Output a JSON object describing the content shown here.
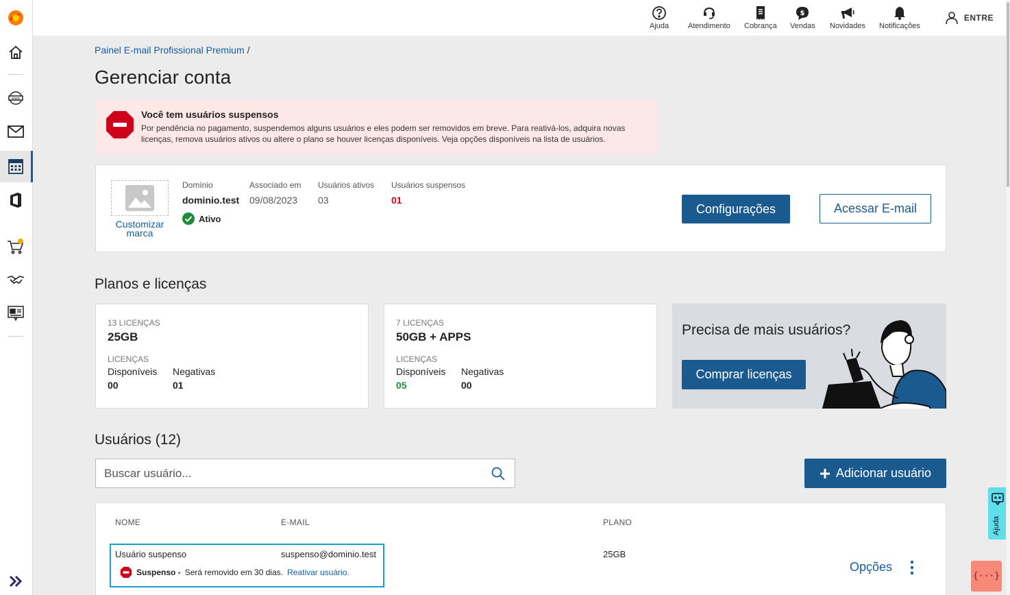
{
  "topbar": {
    "items": [
      {
        "label": "Ajuda",
        "icon": "help-circle-icon"
      },
      {
        "label": "Atendimento",
        "icon": "headset-icon"
      },
      {
        "label": "Cobrança",
        "icon": "receipt-icon"
      },
      {
        "label": "Vendas",
        "icon": "dollar-bubble-icon"
      },
      {
        "label": "Novidades",
        "icon": "megaphone-icon"
      },
      {
        "label": "Notificações",
        "icon": "bell-icon"
      }
    ],
    "login_label": "ENTRE"
  },
  "sidebar": {
    "items": [
      {
        "icon": "brand-logo-icon"
      },
      {
        "icon": "home-icon"
      },
      {
        "icon": "domain-www-icon"
      },
      {
        "icon": "mail-icon"
      },
      {
        "icon": "dashboard-grid-icon",
        "active": true
      },
      {
        "icon": "office-icon"
      },
      {
        "icon": "cart-icon"
      },
      {
        "icon": "handshake-icon"
      },
      {
        "icon": "site-builder-icon"
      }
    ],
    "expand_icon": "double-chevron-right-icon"
  },
  "breadcrumb": {
    "link": "Painel E-mail Profissional Premium",
    "separator": "/"
  },
  "page_title": "Gerenciar conta",
  "alert": {
    "title": "Você tem usuários suspensos",
    "text": "Por pendência no pagamento, suspendemos alguns usuários e eles podem ser removidos em breve. Para reativá-los, adquira novas licenças, remova usuários ativos ou altere o plano se houver licenças disponíveis. Veja opções disponíveis na lista de usuários."
  },
  "account": {
    "customize_label": "Customizar marca",
    "domain_label": "Domínio",
    "domain_value": "dominio.test",
    "status": "Ativo",
    "associated_label": "Associado em",
    "associated_value": "09/08/2023",
    "active_users_label": "Usuários ativos",
    "active_users_value": "03",
    "suspended_users_label": "Usuários suspensos",
    "suspended_users_value": "01",
    "settings_button": "Configurações",
    "access_button": "Acessar E-mail"
  },
  "plans": {
    "title": "Planos e licenças",
    "cards": [
      {
        "count": "13 LICENÇAS",
        "name": "25GB",
        "licenses_label": "LICENÇAS",
        "available_label": "Disponíveis",
        "available": "00",
        "negative_label": "Negativas",
        "negative": "01"
      },
      {
        "count": "7 LICENÇAS",
        "name": "50GB + APPS",
        "licenses_label": "LICENÇAS",
        "available_label": "Disponíveis",
        "available": "05",
        "negative_label": "Negativas",
        "negative": "00"
      }
    ],
    "promo": {
      "title": "Precisa de mais usuários?",
      "button": "Comprar licenças"
    }
  },
  "users": {
    "title": "Usuários (12)",
    "search_placeholder": "Buscar usuário...",
    "add_button": "Adicionar usuário",
    "columns": [
      "NOME",
      "E-MAIL",
      "PLANO"
    ],
    "rows": [
      {
        "name": "Usuário suspenso",
        "email": "suspenso@dominio.test",
        "plan": "25GB",
        "status_bold": "Suspenso -",
        "status_text": "Será removido em 30 dias.",
        "status_link": "Reativar usuário.",
        "options_label": "Opções"
      }
    ]
  },
  "help_tab": "Ajuda",
  "debug_button": "{···}",
  "colors": {
    "primary": "#1a5a8e",
    "link": "#1a5ca0",
    "danger": "#d0021b",
    "success": "#1e8c3a",
    "alert_bg": "#fde8e8"
  }
}
